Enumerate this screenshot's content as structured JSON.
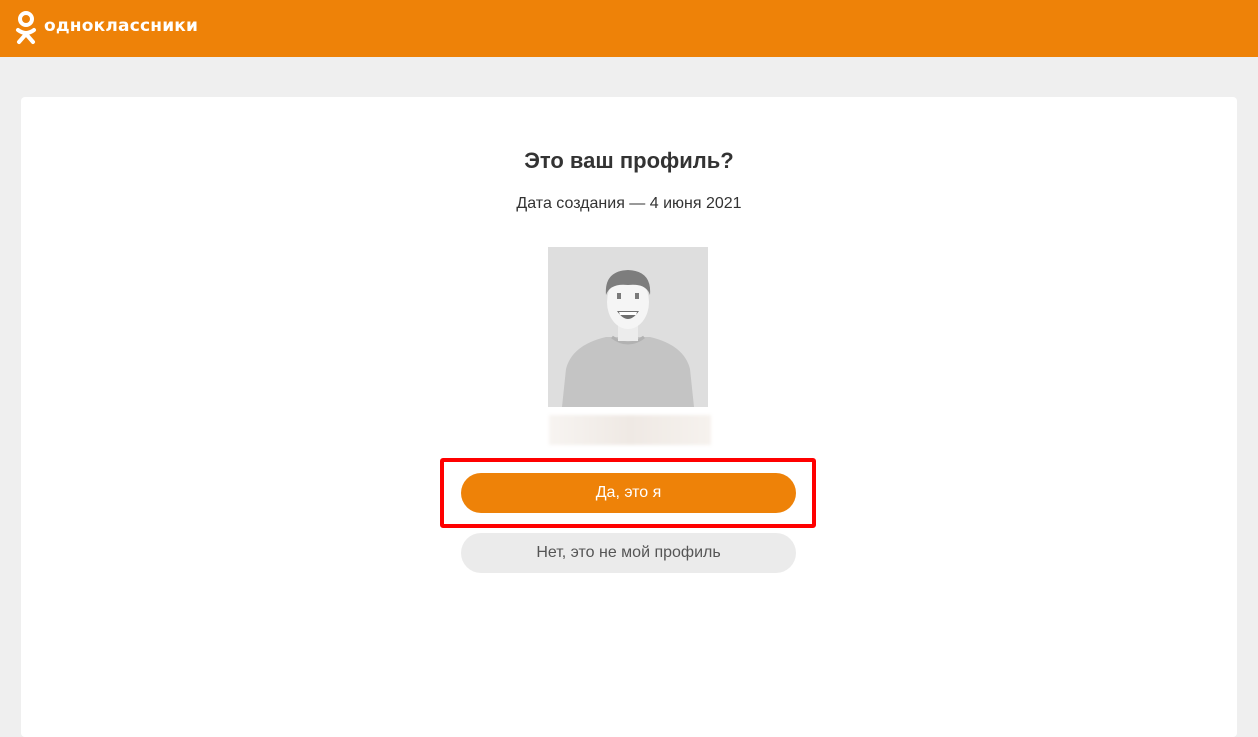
{
  "header": {
    "logo_icon": "odnoklassniki-logo-icon",
    "logo_text": "одноклассники",
    "background_color": "#ee8208"
  },
  "main": {
    "title": "Это ваш профиль?",
    "created": "Дата создания — 4 июня 2021",
    "avatar_icon": "default-male-avatar",
    "confirm_label": "Да, это я",
    "deny_label": "Нет, это не мой профиль"
  },
  "colors": {
    "accent": "#ee8208",
    "highlight": "#ff0000",
    "page_background": "#efefef"
  }
}
